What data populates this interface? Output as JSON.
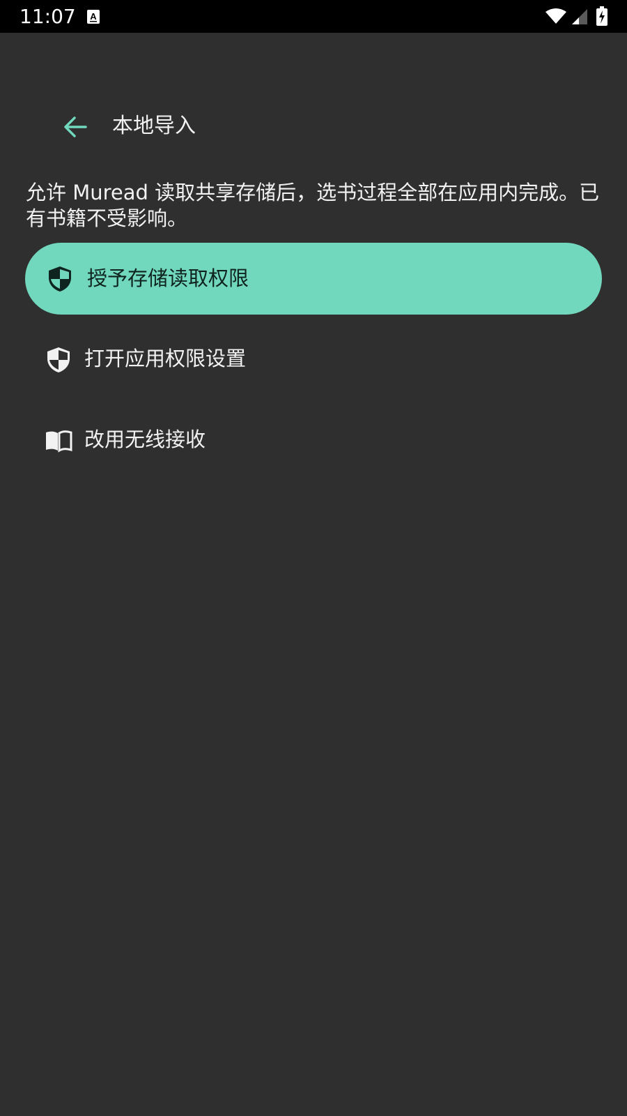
{
  "status_bar": {
    "time": "11:07",
    "notification_icon": "text-a-icon",
    "wifi_icon": "wifi-icon",
    "signal_icon": "cell-signal-icon",
    "battery_icon": "battery-charging-icon"
  },
  "header": {
    "back_icon": "arrow-left-icon",
    "title": "本地导入"
  },
  "main": {
    "description": "允许 Muread 读取共享存储后，选书过程全部在应用内完成。已有书籍不受影响。",
    "primary_action": {
      "label": "授予存储读取权限",
      "icon": "shield-icon"
    },
    "secondary_actions": [
      {
        "label": "打开应用权限设置",
        "icon": "shield-icon"
      },
      {
        "label": "改用无线接收",
        "icon": "book-open-icon"
      }
    ]
  },
  "colors": {
    "background": "#2f2f2f",
    "status_bar": "#000000",
    "accent": "#71d7bd",
    "on_accent": "#10241f",
    "text": "#f2f2f2"
  }
}
